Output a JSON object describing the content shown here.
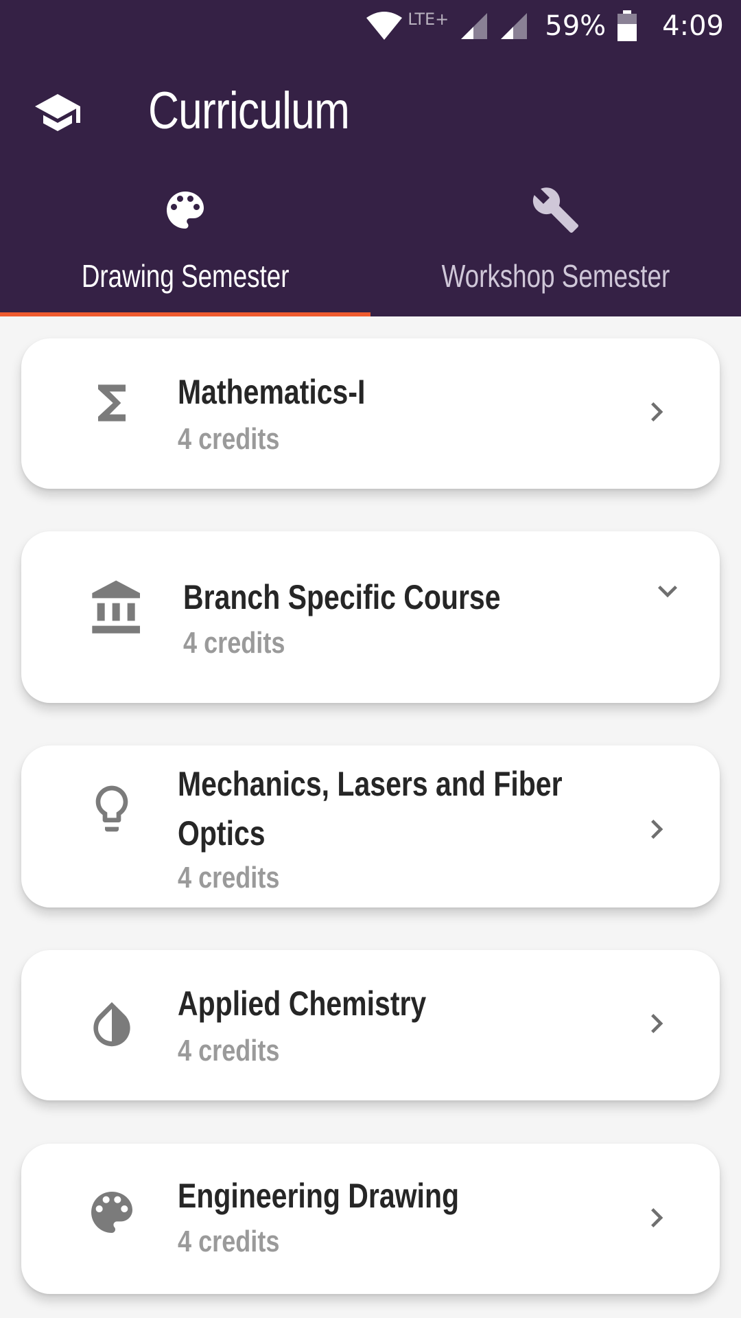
{
  "status_bar": {
    "network": "LTE+",
    "battery_percent": "59%",
    "time": "4:09"
  },
  "header": {
    "title": "Curriculum",
    "app_icon": "graduation-cap-icon"
  },
  "tabs": [
    {
      "label": "Drawing Semester",
      "icon": "palette-icon",
      "active": true
    },
    {
      "label": "Workshop Semester",
      "icon": "wrench-icon",
      "active": false
    }
  ],
  "colors": {
    "header_bg": "#352145",
    "tab_indicator": "#ef5b2f",
    "card_bg": "#ffffff",
    "page_bg": "#f5f5f5"
  },
  "courses": [
    {
      "title": "Mathematics-I",
      "credits": "4 credits",
      "icon": "sigma-icon",
      "action": "chevron-right-icon"
    },
    {
      "title": "Branch Specific Course",
      "credits": "4 credits",
      "icon": "bank-icon",
      "action": "chevron-down-icon"
    },
    {
      "title": "Mechanics, Lasers and Fiber",
      "title_line2": "Optics",
      "credits": "4 credits",
      "icon": "lightbulb-icon",
      "action": "chevron-right-icon"
    },
    {
      "title": "Applied Chemistry",
      "credits": "4 credits",
      "icon": "drop-icon",
      "action": "chevron-right-icon"
    },
    {
      "title": "Engineering Drawing",
      "credits": "4 credits",
      "icon": "palette-icon",
      "action": "chevron-right-icon"
    }
  ]
}
